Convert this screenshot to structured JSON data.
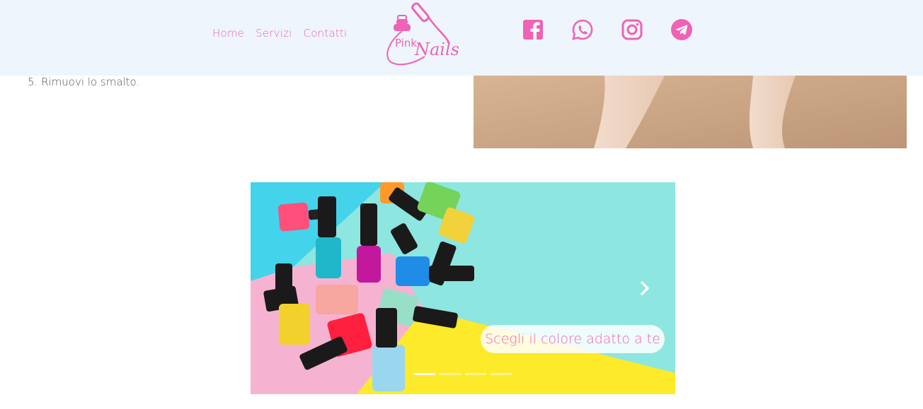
{
  "header": {
    "nav": [
      {
        "label": "Home"
      },
      {
        "label": "Servizi"
      },
      {
        "label": "Contatti"
      }
    ],
    "logo": {
      "line1": "Pink",
      "line2": "Nails",
      "color": "#f062b6"
    },
    "social": [
      {
        "icon": "facebook-icon"
      },
      {
        "icon": "whatsapp-icon"
      },
      {
        "icon": "instagram-icon"
      },
      {
        "icon": "telegram-icon"
      }
    ],
    "accent_color": "#f062b6",
    "background": "#eef5fd"
  },
  "content": {
    "step_text": "5. Rimuovi lo smalto."
  },
  "carousel": {
    "caption": "Scegli il colore adatto a te",
    "slide_count": 4,
    "active_index": 0
  }
}
